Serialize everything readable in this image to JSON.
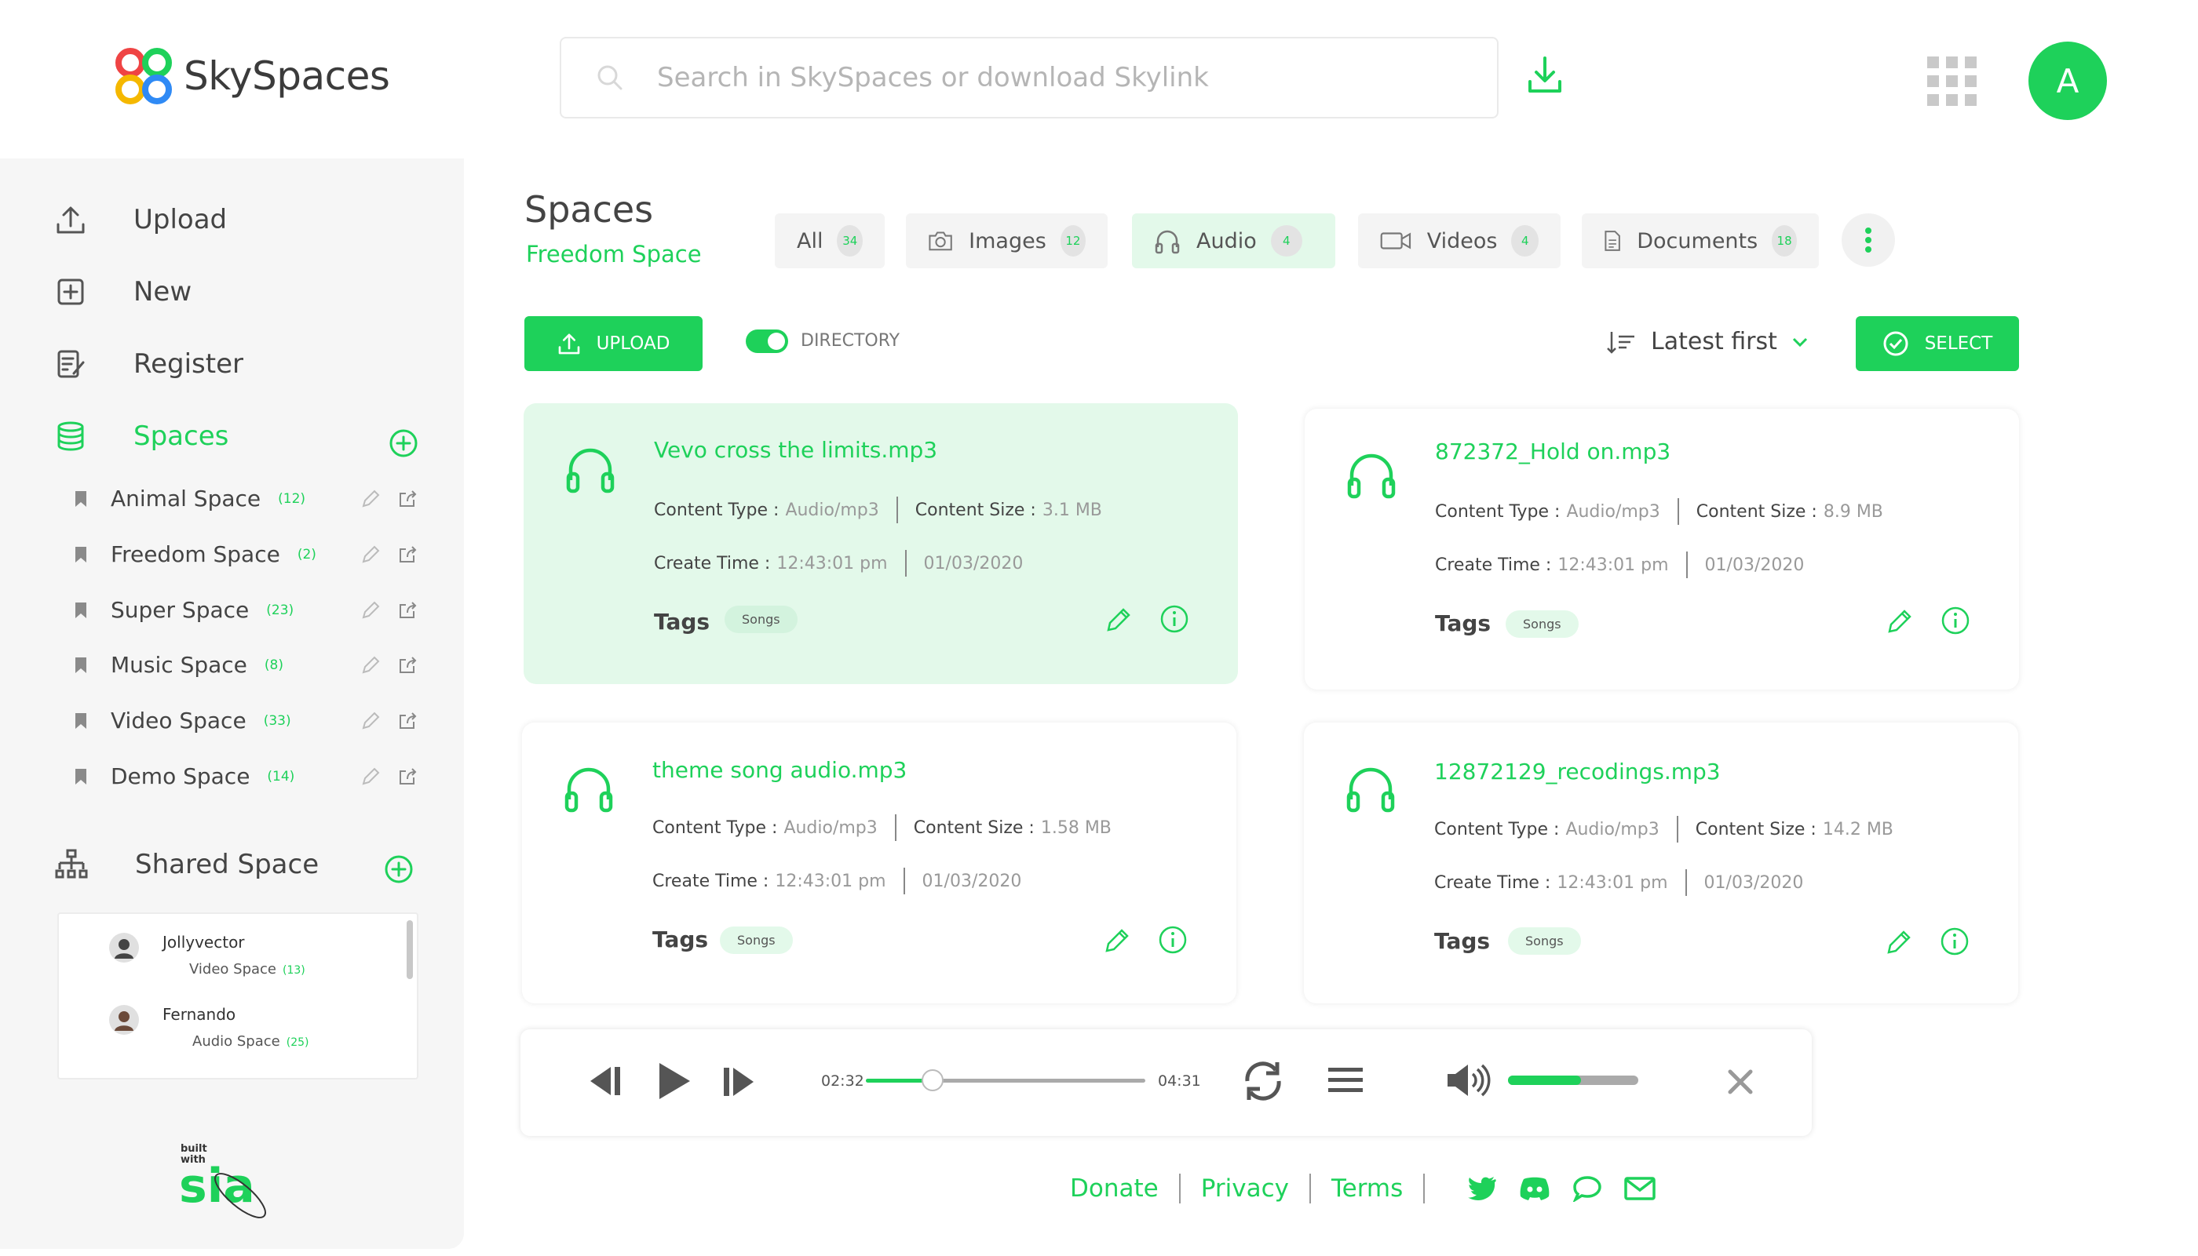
{
  "app": {
    "name": "SkySpaces",
    "accent": "#1ed15a"
  },
  "search": {
    "placeholder": "Search in SkySpaces or download Skylink"
  },
  "user": {
    "initial": "A"
  },
  "sidebar": {
    "nav": [
      {
        "label": "Upload",
        "icon": "upload-icon"
      },
      {
        "label": "New",
        "icon": "plus-square-icon"
      },
      {
        "label": "Register",
        "icon": "register-icon"
      },
      {
        "label": "Spaces",
        "icon": "database-icon"
      }
    ],
    "spaces": [
      {
        "name": "Animal Space",
        "count": "(12)"
      },
      {
        "name": "Freedom Space",
        "count": "(2)"
      },
      {
        "name": "Super Space",
        "count": "(23)"
      },
      {
        "name": "Music Space",
        "count": "(8)"
      },
      {
        "name": "Video Space",
        "count": "(33)"
      },
      {
        "name": "Demo Space",
        "count": "(14)"
      }
    ],
    "shared_title": "Shared Space",
    "shared_users": [
      {
        "name": "Jollyvector",
        "space": "Video Space",
        "count": "(13)"
      },
      {
        "name": "Fernando",
        "space": "Audio Space",
        "count": "(25)"
      }
    ],
    "built_with": {
      "line1": "built",
      "line2": "with",
      "brand": "sia"
    }
  },
  "main": {
    "title": "Spaces",
    "subtitle": "Freedom Space",
    "tabs": [
      {
        "label": "All",
        "count": "34"
      },
      {
        "label": "Images",
        "count": "12"
      },
      {
        "label": "Audio",
        "count": "4"
      },
      {
        "label": "Videos",
        "count": "4"
      },
      {
        "label": "Documents",
        "count": "18"
      }
    ],
    "upload_label": "UPLOAD",
    "directory_label": "DIRECTORY",
    "sort_label": "Latest first",
    "select_label": "SELECT"
  },
  "labels": {
    "content_type": "Content Type :",
    "content_size": "Content Size :",
    "create_time": "Create Time :",
    "tags": "Tags"
  },
  "files": [
    {
      "name": "Vevo cross the limits.mp3",
      "type": "Audio/mp3",
      "size": "3.1 MB",
      "time": "12:43:01 pm",
      "date": "01/03/2020",
      "tag": "Songs"
    },
    {
      "name": "872372_Hold on.mp3",
      "type": "Audio/mp3",
      "size": "8.9 MB",
      "time": "12:43:01 pm",
      "date": "01/03/2020",
      "tag": "Songs"
    },
    {
      "name": "theme song audio.mp3",
      "type": "Audio/mp3",
      "size": "1.58 MB",
      "time": "12:43:01 pm",
      "date": "01/03/2020",
      "tag": "Songs"
    },
    {
      "name": "12872129_recodings.mp3",
      "type": "Audio/mp3",
      "size": "14.2 MB",
      "time": "12:43:01 pm",
      "date": "01/03/2020",
      "tag": "Songs"
    }
  ],
  "player": {
    "current": "02:32",
    "total": "04:31",
    "progress": 0.24,
    "volume": 0.56
  },
  "footer": {
    "links": [
      "Donate",
      "Privacy",
      "Terms"
    ]
  }
}
